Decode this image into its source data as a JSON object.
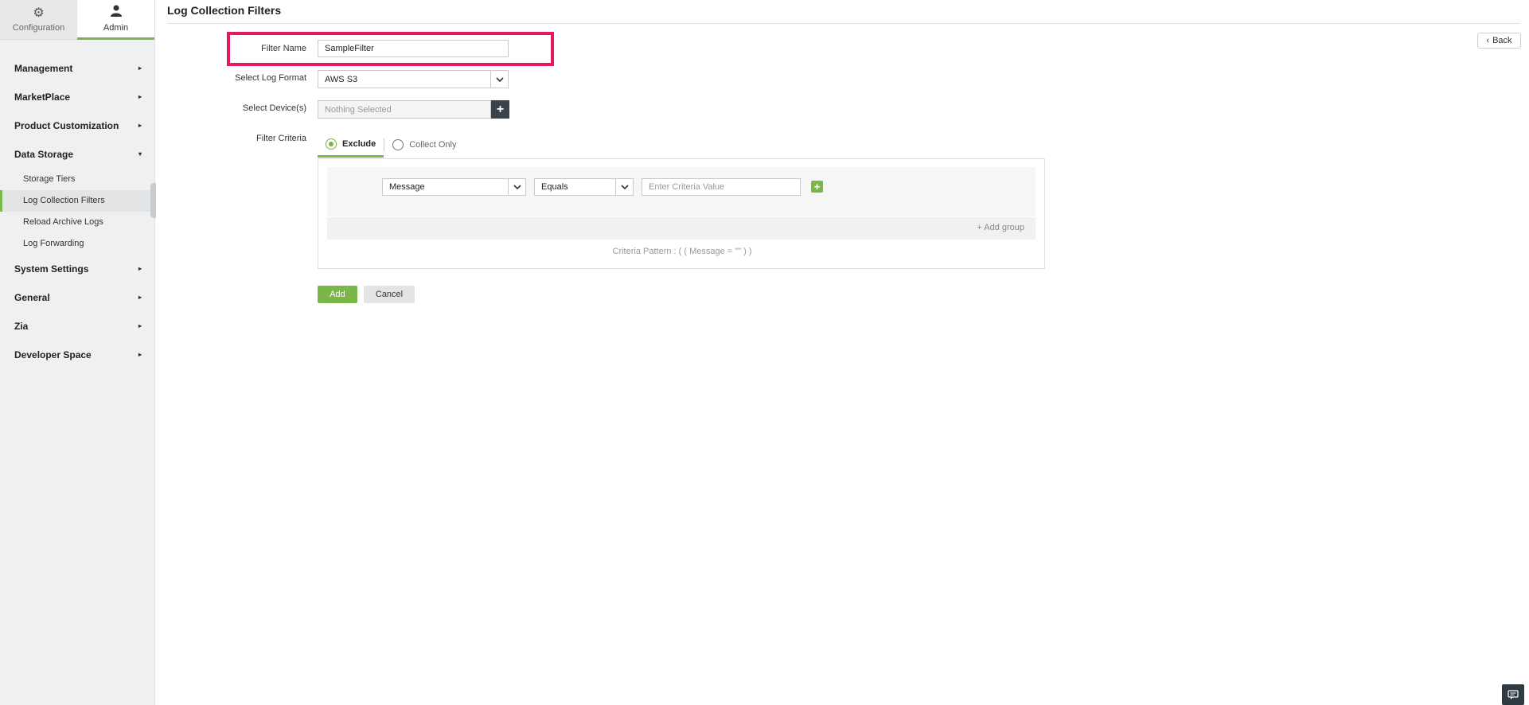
{
  "top_tabs": {
    "configuration": {
      "label": "Configuration",
      "icon": "gear-icon"
    },
    "admin": {
      "label": "Admin",
      "icon": "user-icon"
    }
  },
  "sidebar": {
    "items": [
      {
        "label": "Management",
        "caret": "▸"
      },
      {
        "label": "MarketPlace",
        "caret": "▸"
      },
      {
        "label": "Product Customization",
        "caret": "▸"
      },
      {
        "label": "Data Storage",
        "caret": "▾"
      },
      {
        "label": "System Settings",
        "caret": "▸"
      },
      {
        "label": "General",
        "caret": "▸"
      },
      {
        "label": "Zia",
        "caret": "▸"
      },
      {
        "label": "Developer Space",
        "caret": "▸"
      }
    ],
    "sub_items": [
      {
        "label": "Storage Tiers"
      },
      {
        "label": "Log Collection Filters"
      },
      {
        "label": "Reload Archive Logs"
      },
      {
        "label": "Log Forwarding"
      }
    ]
  },
  "page": {
    "title": "Log Collection Filters",
    "back_label": "Back"
  },
  "form": {
    "filter_name_label": "Filter Name",
    "filter_name_value": "SampleFilter",
    "log_format_label": "Select Log Format",
    "log_format_value": "AWS S3",
    "devices_label": "Select Device(s)",
    "devices_placeholder": "Nothing Selected",
    "filter_criteria_label": "Filter Criteria"
  },
  "criteria": {
    "tab_exclude": "Exclude",
    "tab_collect_only": "Collect Only",
    "field_value": "Message",
    "operator_value": "Equals",
    "value_placeholder": "Enter Criteria Value",
    "add_group_label": "Add group",
    "pattern_text": "Criteria Pattern : ( ( Message = \"\" ) )"
  },
  "buttons": {
    "add": "Add",
    "cancel": "Cancel"
  },
  "colors": {
    "accent_green": "#7ab648",
    "highlight_red": "#e8195a",
    "dark_button": "#3a4348"
  }
}
